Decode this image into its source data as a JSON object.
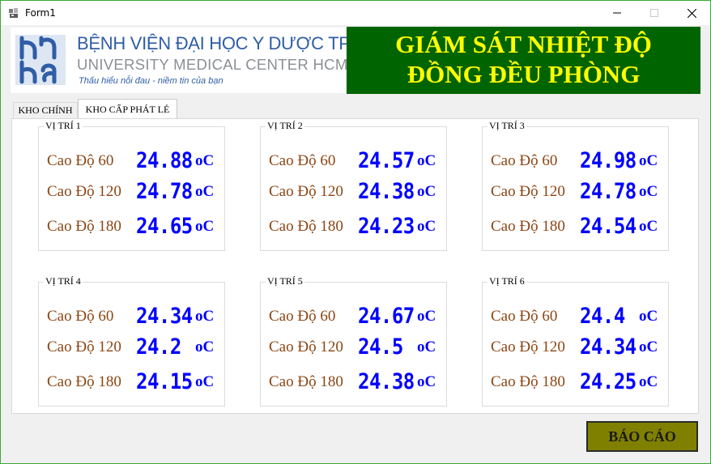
{
  "window": {
    "title": "Form1"
  },
  "logo": {
    "line1": "BỆNH VIỆN ĐẠI HỌC Y DƯỢC TPHCM",
    "line2": "UNIVERSITY MEDICAL CENTER HCMC",
    "line3": "Thấu hiểu nỗi đau - niềm tin của bạn"
  },
  "banner": {
    "line1": "GIÁM SÁT NHIỆT ĐỘ",
    "line2": "ĐỒNG ĐỀU PHÒNG"
  },
  "tabs": [
    {
      "label": "KHO CHÍNH",
      "selected": false
    },
    {
      "label": "KHO CẤP PHÁT LẺ",
      "selected": true
    }
  ],
  "positions": [
    {
      "title": "VỊ TRÍ 1",
      "rows": [
        {
          "label": "Cao Độ 60",
          "value": "24.88",
          "unit": "oC"
        },
        {
          "label": "Cao Độ 120",
          "value": "24.78",
          "unit": "oC"
        },
        {
          "label": "Cao Độ 180",
          "value": "24.65",
          "unit": "oC"
        }
      ]
    },
    {
      "title": "VỊ TRÍ 2",
      "rows": [
        {
          "label": "Cao Độ 60",
          "value": "24.57",
          "unit": "oC"
        },
        {
          "label": "Cao Độ 120",
          "value": "24.38",
          "unit": "oC"
        },
        {
          "label": "Cao Độ 180",
          "value": "24.23",
          "unit": "oC"
        }
      ]
    },
    {
      "title": "VỊ TRÍ 3",
      "rows": [
        {
          "label": "Cao Độ 60",
          "value": "24.98",
          "unit": "oC"
        },
        {
          "label": "Cao Độ 120",
          "value": "24.78",
          "unit": "oC"
        },
        {
          "label": "Cao Độ 180",
          "value": "24.54",
          "unit": "oC"
        }
      ]
    },
    {
      "title": "VỊ TRÍ 4",
      "rows": [
        {
          "label": "Cao Độ 60",
          "value": "24.34",
          "unit": "oC"
        },
        {
          "label": "Cao Độ 120",
          "value": "24.2",
          "unit": "oC"
        },
        {
          "label": "Cao Độ 180",
          "value": "24.15",
          "unit": "oC"
        }
      ]
    },
    {
      "title": "VỊ TRÍ 5",
      "rows": [
        {
          "label": "Cao Độ 60",
          "value": "24.67",
          "unit": "oC"
        },
        {
          "label": "Cao Độ 120",
          "value": "24.5",
          "unit": "oC"
        },
        {
          "label": "Cao Độ 180",
          "value": "24.38",
          "unit": "oC"
        }
      ]
    },
    {
      "title": "VỊ TRÍ 6",
      "rows": [
        {
          "label": "Cao Độ 60",
          "value": "24.4",
          "unit": "oC"
        },
        {
          "label": "Cao Độ 120",
          "value": "24.34",
          "unit": "oC"
        },
        {
          "label": "Cao Độ 180",
          "value": "24.25",
          "unit": "oC"
        }
      ]
    }
  ],
  "report_button": {
    "label": "BÁO CÁO"
  },
  "colors": {
    "banner_bg": "#006400",
    "banner_text": "#ffff00",
    "label_text": "#8b4513",
    "value_text": "#0000ff",
    "button_bg": "#808000",
    "window_border": "#3aa83a"
  }
}
